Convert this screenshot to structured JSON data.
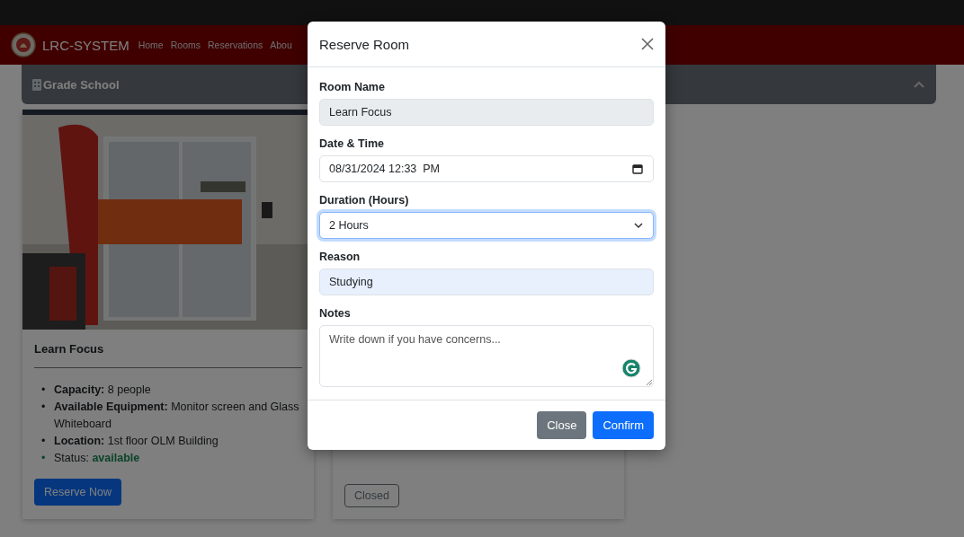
{
  "navbar": {
    "brand": "LRC-SYSTEM",
    "links": [
      {
        "label": "Home"
      },
      {
        "label": "Rooms"
      },
      {
        "label": "Reservations"
      },
      {
        "label": "Abou"
      }
    ]
  },
  "section": {
    "title": "Grade School",
    "expanded": true
  },
  "cards": [
    {
      "kind": "room",
      "title": "Learn Focus",
      "details": [
        {
          "marker": "•",
          "label": "Capacity:",
          "value": "8 people"
        },
        {
          "marker": "•",
          "label": "Available Equipment:",
          "value": "Monitor screen and Glass Whiteboard"
        },
        {
          "marker": "•",
          "label": "Location:",
          "value": "1st floor OLM Building"
        }
      ],
      "status": {
        "marker": "•",
        "label": "Status:",
        "value": "available",
        "kind": "available"
      },
      "button": {
        "label": "Reserve Now",
        "kind": "primary"
      }
    },
    {
      "kind": "covered",
      "button": {
        "label": "Closed",
        "kind": "outline"
      }
    }
  ],
  "modal": {
    "title": "Reserve Room",
    "fields": [
      {
        "kind": "text",
        "label": "Room Name",
        "value": "Learn Focus",
        "readonly": true,
        "focused": false,
        "autofilled": false
      },
      {
        "kind": "datetime",
        "label": "Date & Time",
        "value": "08/31/2024 12:33  PM",
        "readonly": false,
        "focused": false,
        "autofilled": false
      },
      {
        "kind": "select",
        "label": "Duration (Hours)",
        "value": "2 Hours",
        "readonly": false,
        "focused": true,
        "autofilled": false
      },
      {
        "kind": "text",
        "label": "Reason",
        "value": "Studying",
        "readonly": false,
        "focused": false,
        "autofilled": true
      },
      {
        "kind": "textarea",
        "label": "Notes",
        "placeholder": "Write down if you have concerns...",
        "readonly": false,
        "focused": false,
        "autofilled": false
      }
    ],
    "buttons": [
      {
        "label": "Close",
        "kind": "secondary"
      },
      {
        "label": "Confirm",
        "kind": "primary"
      }
    ]
  }
}
